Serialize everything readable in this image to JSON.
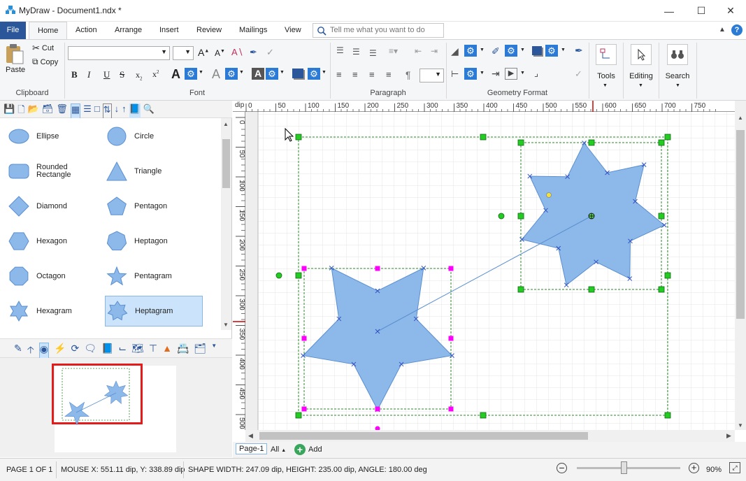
{
  "app": {
    "title": "MyDraw - Document1.ndx *"
  },
  "tabs": [
    {
      "label": "File"
    },
    {
      "label": "Home"
    },
    {
      "label": "Action"
    },
    {
      "label": "Arrange"
    },
    {
      "label": "Insert"
    },
    {
      "label": "Review"
    },
    {
      "label": "Mailings"
    },
    {
      "label": "View"
    }
  ],
  "tellme": {
    "placeholder": "Tell me what you want to do"
  },
  "ribbon": {
    "clipboard": {
      "label": "Clipboard",
      "paste": "Paste",
      "cut": "Cut",
      "copy": "Copy"
    },
    "font": {
      "label": "Font"
    },
    "paragraph": {
      "label": "Paragraph"
    },
    "geometry": {
      "label": "Geometry Format"
    },
    "tools": {
      "label": "Tools"
    },
    "editing": {
      "label": "Editing"
    },
    "search": {
      "label": "Search"
    }
  },
  "shapes": [
    {
      "label": "Ellipse",
      "icon": "ellipse"
    },
    {
      "label": "Circle",
      "icon": "circle"
    },
    {
      "label": "Rounded\nRectangle",
      "icon": "rounded-rectangle"
    },
    {
      "label": "Triangle",
      "icon": "triangle"
    },
    {
      "label": "Diamond",
      "icon": "diamond"
    },
    {
      "label": "Pentagon",
      "icon": "pentagon"
    },
    {
      "label": "Hexagon",
      "icon": "hexagon"
    },
    {
      "label": "Heptagon",
      "icon": "heptagon"
    },
    {
      "label": "Octagon",
      "icon": "octagon"
    },
    {
      "label": "Pentagram",
      "icon": "pentagram"
    },
    {
      "label": "Hexagram",
      "icon": "hexagram"
    },
    {
      "label": "Heptagram",
      "icon": "heptagram",
      "selected": true
    }
  ],
  "ruler": {
    "unit": "dip",
    "h_ticks": [
      "0",
      "50",
      "100",
      "150",
      "200",
      "250",
      "300",
      "350",
      "400",
      "450",
      "500",
      "550",
      "600",
      "650",
      "700",
      "750"
    ],
    "v_ticks": [
      "0",
      "50",
      "100",
      "150",
      "200",
      "250",
      "300",
      "350",
      "400",
      "450",
      "500"
    ]
  },
  "pages": {
    "current": "Page-1",
    "all": "All",
    "add": "Add"
  },
  "status": {
    "page": "PAGE 1 OF 1",
    "mouse": "MOUSE X: 551.11 dip, Y: 338.89 dip",
    "shape": "SHAPE WIDTH: 247.09 dip, HEIGHT: 235.00 dip, ANGLE: 180.00 deg",
    "zoom": "90%",
    "zoom_level": 0.45
  },
  "colors": {
    "accent": "#2b579a",
    "shape_fill": "#8db8ea",
    "shape_stroke": "#5a8fd0",
    "handle_green": "#22cc22",
    "handle_magenta": "#ff00ff"
  }
}
